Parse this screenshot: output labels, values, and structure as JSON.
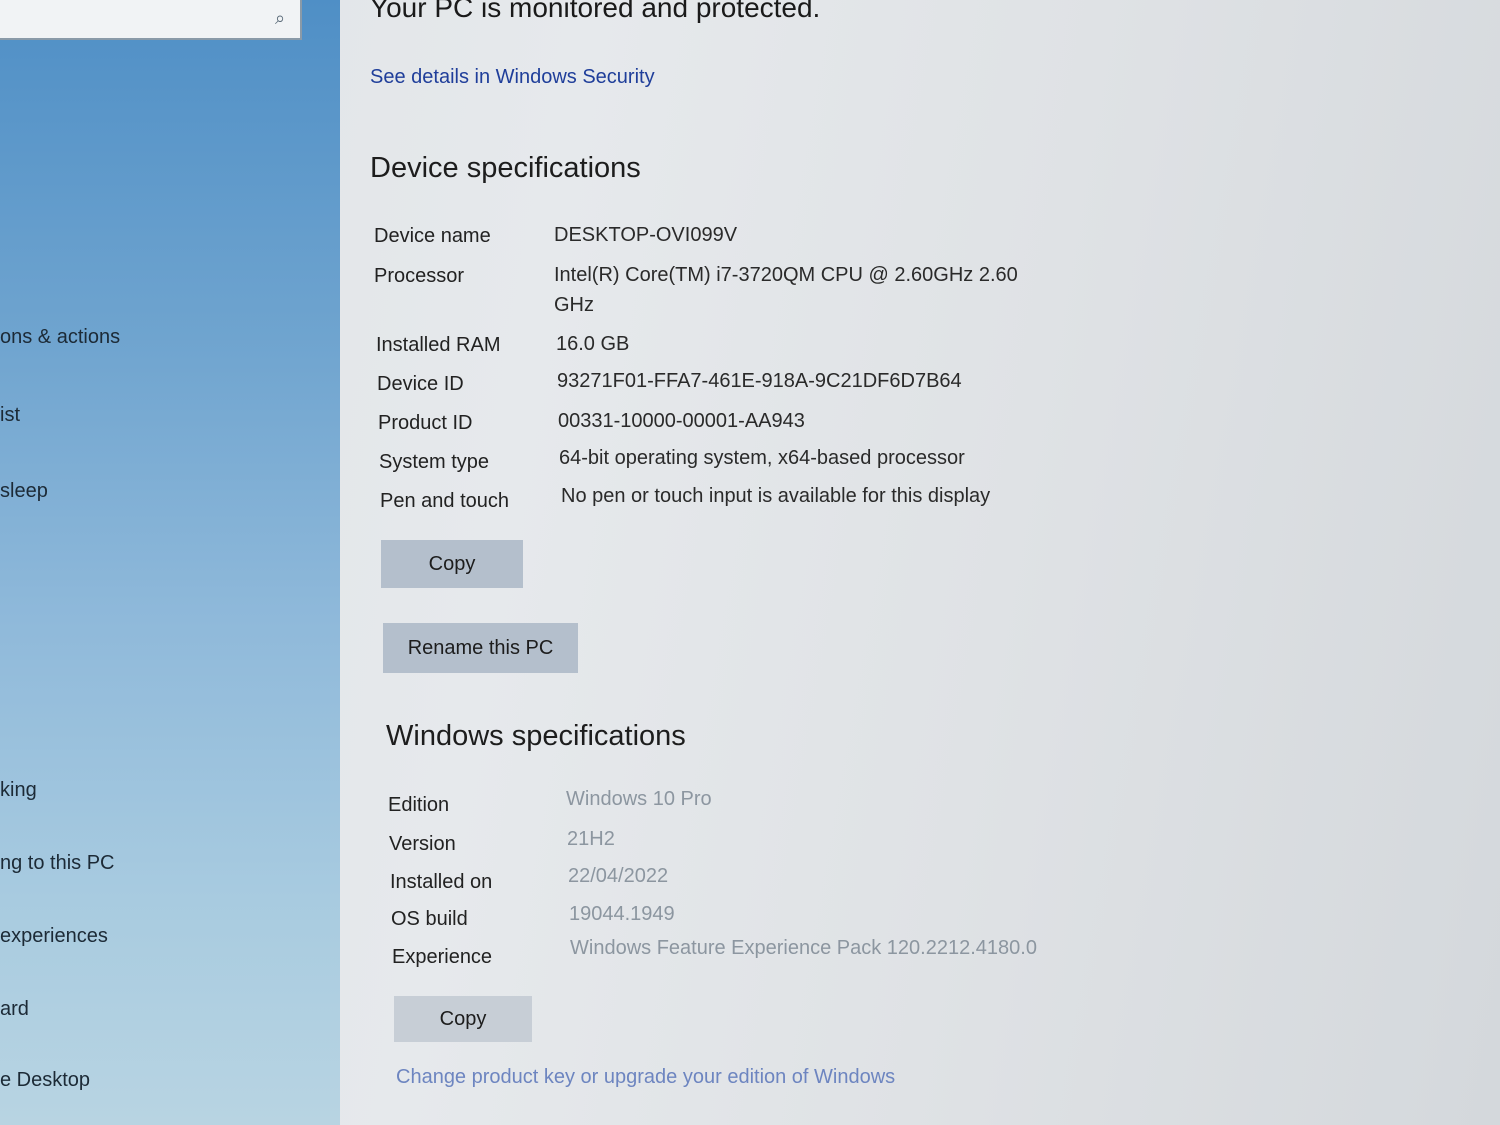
{
  "sidebar": {
    "search": {
      "placeholder": "",
      "value": ""
    },
    "items": [
      {
        "label": "ons & actions"
      },
      {
        "label": "ist"
      },
      {
        "label": "sleep"
      },
      {
        "label": "king"
      },
      {
        "label": "ng to this PC"
      },
      {
        "label": " experiences"
      },
      {
        "label": "ard"
      },
      {
        "label": "e Desktop"
      }
    ]
  },
  "main": {
    "status_heading": "Your PC is monitored and protected.",
    "security_link": "See details in Windows Security",
    "device": {
      "title": "Device specifications",
      "rows": [
        {
          "label": "Device name",
          "value": "DESKTOP-OVI099V"
        },
        {
          "label": "Processor",
          "value": "Intel(R) Core(TM) i7-3720QM CPU @ 2.60GHz   2.60",
          "value2": "GHz"
        },
        {
          "label": "Installed RAM",
          "value": "16.0 GB"
        },
        {
          "label": "Device ID",
          "value": "93271F01-FFA7-461E-918A-9C21DF6D7B64"
        },
        {
          "label": "Product ID",
          "value": "00331-10000-00001-AA943"
        },
        {
          "label": "System type",
          "value": "64-bit operating system, x64-based processor"
        },
        {
          "label": "Pen and touch",
          "value": "No pen or touch input is available for this display"
        }
      ],
      "copy_label": "Copy",
      "rename_label": "Rename this PC"
    },
    "windows": {
      "title": "Windows specifications",
      "rows": [
        {
          "label": "Edition",
          "value": "Windows 10 Pro"
        },
        {
          "label": "Version",
          "value": "21H2"
        },
        {
          "label": "Installed on",
          "value": "22/04/2022"
        },
        {
          "label": "OS build",
          "value": "19044.1949"
        },
        {
          "label": "Experience",
          "value": "Windows Feature Experience Pack 120.2212.4180.0"
        }
      ],
      "copy_label": "Copy",
      "change_key_link": "Change product key or upgrade your edition of Windows"
    }
  }
}
